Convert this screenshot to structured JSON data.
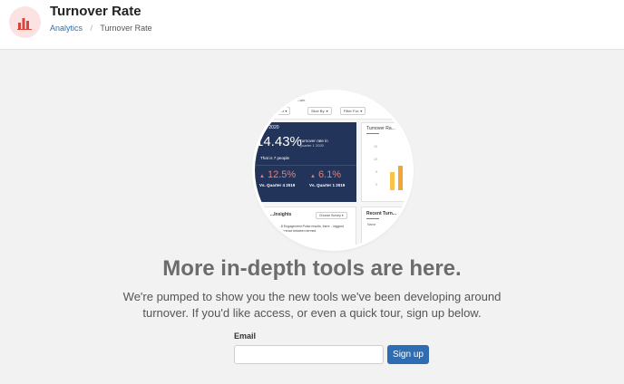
{
  "header": {
    "title": "Turnover Rate",
    "icon": "bar-chart-icon",
    "accent": "#d9443b",
    "breadcrumb": {
      "link": "Analytics",
      "current": "Turnover Rate"
    }
  },
  "preview": {
    "top_title": "Turnover Rate",
    "filters": [
      "...e Quarter ▾",
      "Slice By: ▾",
      "Filter For: ▾"
    ],
    "stat": {
      "quarter": "...r 1 2020",
      "big_value": "14.43%",
      "rate_label": "Turnover rate in",
      "rate_sub": "Quarter 1 2020",
      "people": "That is 7 people",
      "compare": [
        {
          "value": "12.5%",
          "label": "Vs. Quarter 4 2019"
        },
        {
          "value": "6.1%",
          "label": "Vs. Quarter 1 2019"
        }
      ]
    },
    "chart": {
      "title": "Turnover Ra...",
      "y_ticks": [
        "15",
        "10",
        "5",
        "0"
      ]
    },
    "insights": {
      "title": "...Insights",
      "choose": "Choose Survey ▾",
      "text": "...8 Engagement Pulse results, there ...biggest difference between termed"
    },
    "recent": {
      "title": "Recent Turn...",
      "col": "Name"
    }
  },
  "main": {
    "headline": "More in-depth tools are here.",
    "subtext_line1": "We're pumped to show you the new tools we've been developing around",
    "subtext_line2": "turnover. If you'd like access, or even a quick tour, sign up below."
  },
  "form": {
    "email_label": "Email",
    "email_value": "",
    "email_placeholder": "",
    "submit_label": "Sign up"
  }
}
